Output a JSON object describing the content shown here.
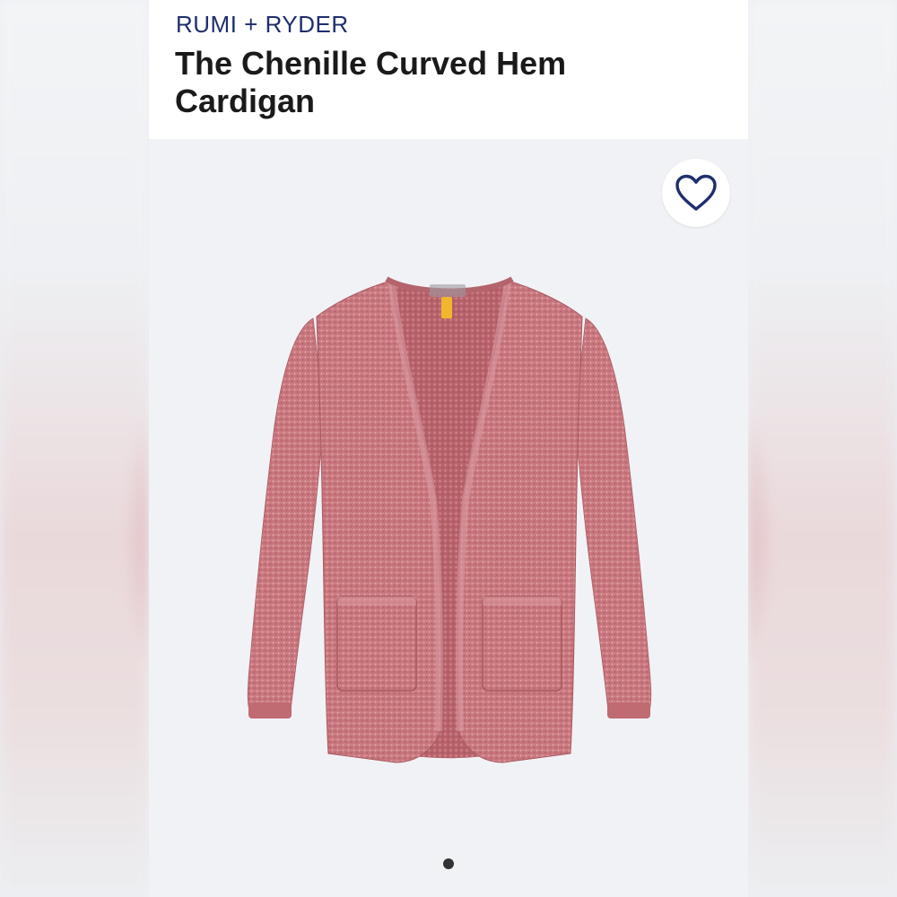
{
  "product": {
    "brand": "RUMI + RYDER",
    "title": "The Chenille Curved Hem Cardigan"
  },
  "icons": {
    "favorite": "heart-outline-icon"
  },
  "gallery": {
    "active_index": 1,
    "total": 1
  },
  "colors": {
    "brand_text": "#1f2e6e",
    "heart_stroke": "#1f2e6e",
    "garment": "#c8767d",
    "tag": "#f2b62e"
  }
}
